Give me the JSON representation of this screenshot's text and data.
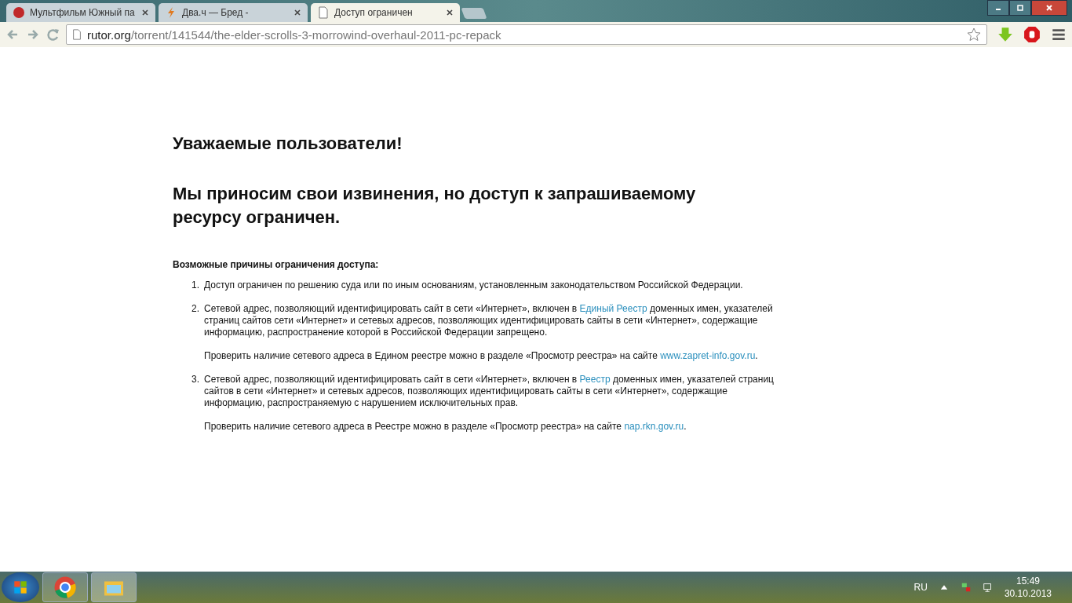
{
  "tabs": [
    {
      "title": "Мультфильм Южный па",
      "selected": false
    },
    {
      "title": "Два.ч — Бред -",
      "selected": false
    },
    {
      "title": "Доступ ограничен",
      "selected": true
    }
  ],
  "address": {
    "host": "rutor.org",
    "path": "/torrent/141544/the-elder-scrolls-3-morrowind-overhaul-2011-pc-repack"
  },
  "page": {
    "greeting": "Уважаемые пользователи!",
    "apology": "Мы приносим свои извинения, но доступ к запрашиваемому ресурсу ограничен.",
    "reasons_title": "Возможные причины ограничения доступа:",
    "reasons": [
      {
        "number": "1.",
        "paragraphs": [
          [
            {
              "kind": "text",
              "text": "Доступ ограничен  по решению суда или по иным основаниям, установленным законодательством Российской Федерации."
            }
          ]
        ]
      },
      {
        "number": "2.",
        "paragraphs": [
          [
            {
              "kind": "text",
              "text": "Сетевой адрес, позволяющий идентифицировать сайт в сети «Интернет», включен в "
            },
            {
              "kind": "link",
              "text": "Единый Реестр"
            },
            {
              "kind": "text",
              "text": " доменных имен, указателей страниц сайтов сети «Интернет» и сетевых адресов, позволяющих идентифицировать сайты в сети «Интернет», содержащие информацию, распространение которой в Российской Федерации запрещено."
            }
          ],
          [
            {
              "kind": "text",
              "text": "Проверить наличие сетевого адреса в Едином реестре можно в разделе «Просмотр реестра» на сайте "
            },
            {
              "kind": "link",
              "text": "www.zapret-info.gov.ru"
            },
            {
              "kind": "text",
              "text": "."
            }
          ]
        ]
      },
      {
        "number": "3.",
        "paragraphs": [
          [
            {
              "kind": "text",
              "text": "Сетевой адрес, позволяющий идентифицировать сайт в сети «Интернет», включен в "
            },
            {
              "kind": "link",
              "text": "Реестр"
            },
            {
              "kind": "text",
              "text": " доменных имен, указателей страниц сайтов в сети «Интернет» и сетевых адресов, позволяющих идентифицировать сайты в сети «Интернет», содержащие информацию, распространяемую с нарушением исключительных прав."
            }
          ],
          [
            {
              "kind": "text",
              "text": "Проверить наличие сетевого адреса в Реестре можно в разделе «Просмотр реестра» на сайте "
            },
            {
              "kind": "link",
              "text": "nap.rkn.gov.ru"
            },
            {
              "kind": "text",
              "text": "."
            }
          ]
        ]
      }
    ]
  },
  "taskbar": {
    "language": "RU",
    "time": "15:49",
    "date": "30.10.2013"
  }
}
